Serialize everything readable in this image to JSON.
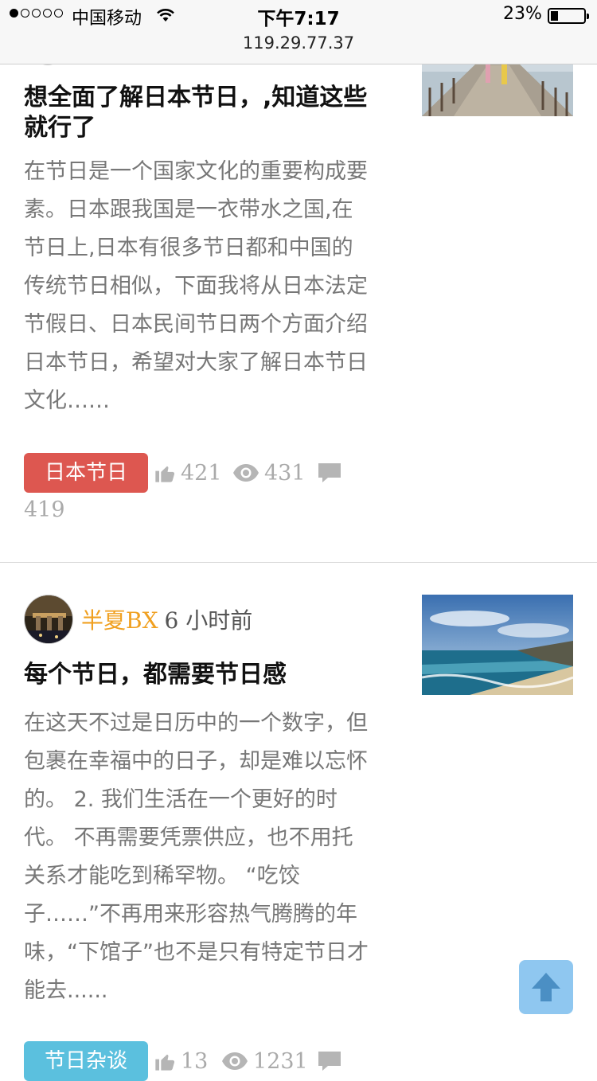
{
  "status_bar": {
    "carrier": "中国移动",
    "time": "下午7:17",
    "url": "119.29.77.37",
    "battery_percent": "23%",
    "battery_level": 0.23
  },
  "articles": [
    {
      "title": "想全面了解日本节日，,知道这些就行了",
      "excerpt": "在节日是一个国家文化的重要构成要素。日本跟我国是一衣带水之国,在节日上,日本有很多节日都和中国的传统节日相似，下面我将从日本法定节假日、日本民间节日两个方面介绍日本节日，希望对大家了解日本节日文化……",
      "tag": "日本节日",
      "likes": "421",
      "views": "431",
      "comments": "419"
    },
    {
      "author": "半夏BX",
      "time": "6 小时前",
      "title": "每个节日，都需要节日感",
      "excerpt": "在这天不过是日历中的一个数字，但包裹在幸福中的日子，却是难以忘怀的。 2. 我们生活在一个更好的时代。 不再需要凭票供应，也不用托关系才能吃到稀罕物。 “吃饺子……”不再用来形容热气腾腾的年味，“下馆子”也不是只有特定节日才能去......",
      "tag": "节日杂谈",
      "likes": "13",
      "views": "1231"
    }
  ],
  "icons": {
    "like": "thumbs-up-icon",
    "view": "eye-icon",
    "comment": "comment-icon",
    "back_to_top": "arrow-up-icon"
  },
  "colors": {
    "author": "#f0a020",
    "tag_red": "#dd5750",
    "tag_blue": "#5bc0de",
    "back_to_top": "#8fc7f0"
  }
}
